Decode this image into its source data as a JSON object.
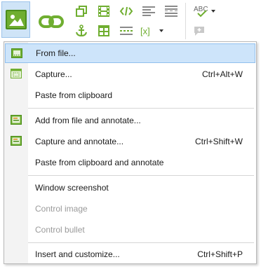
{
  "ribbon": {
    "tools": [
      {
        "name": "insert-image",
        "icon": "image-icon"
      },
      {
        "name": "insert-link",
        "icon": "link-icon"
      },
      {
        "name": "copy",
        "icon": "copy-icon"
      },
      {
        "name": "video",
        "icon": "film-icon"
      },
      {
        "name": "code",
        "icon": "code-icon"
      },
      {
        "name": "align",
        "icon": "align-icon"
      },
      {
        "name": "page-break",
        "icon": "page-break-icon"
      },
      {
        "name": "spellcheck",
        "icon": "abc-check-icon"
      },
      {
        "name": "anchor",
        "icon": "anchor-icon"
      },
      {
        "name": "table",
        "icon": "table-icon"
      },
      {
        "name": "rule",
        "icon": "rule-icon"
      },
      {
        "name": "variable",
        "icon": "variable-icon"
      },
      {
        "name": "comment",
        "icon": "comment-add-icon"
      }
    ]
  },
  "menu": {
    "items": [
      {
        "label": "From file...",
        "shortcut": "",
        "selected": true
      },
      {
        "label": "Capture...",
        "shortcut": "Ctrl+Alt+W"
      },
      {
        "label": "Paste from clipboard",
        "shortcut": ""
      },
      {
        "label": "Add from file and annotate...",
        "shortcut": ""
      },
      {
        "label": "Capture and annotate...",
        "shortcut": "Ctrl+Shift+W"
      },
      {
        "label": "Paste from clipboard and annotate",
        "shortcut": ""
      },
      {
        "label": "Window screenshot",
        "shortcut": ""
      },
      {
        "label": "Control image",
        "shortcut": "",
        "disabled": true
      },
      {
        "label": "Control bullet",
        "shortcut": "",
        "disabled": true
      },
      {
        "label": "Insert and customize...",
        "shortcut": "Ctrl+Shift+P"
      }
    ]
  },
  "colors": {
    "accent_green": "#6fae30",
    "selection": "#cde4fa",
    "disabled_text": "#9a9a9a"
  }
}
